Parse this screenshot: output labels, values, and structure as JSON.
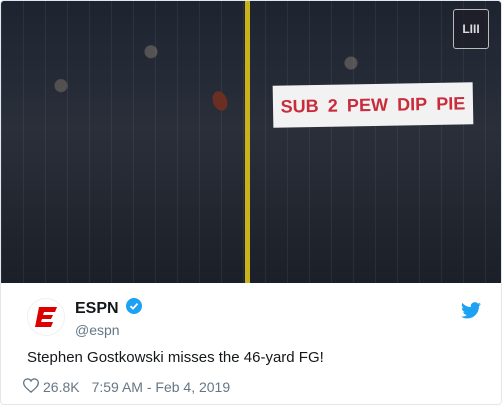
{
  "media": {
    "banner_words": [
      "SUB",
      "2",
      "PEW",
      "DIP",
      "PIE"
    ],
    "logo_text": "LIII"
  },
  "tweet": {
    "author_name": "ESPN",
    "handle": "@espn",
    "text": "Stephen Gostkowski misses the 46-yard FG!",
    "like_count": "26.8K",
    "timestamp": "7:59 AM - Feb 4, 2019"
  },
  "colors": {
    "espn_red": "#dd0000",
    "verified_blue": "#1da1f2",
    "twitter_blue": "#1da1f2"
  }
}
